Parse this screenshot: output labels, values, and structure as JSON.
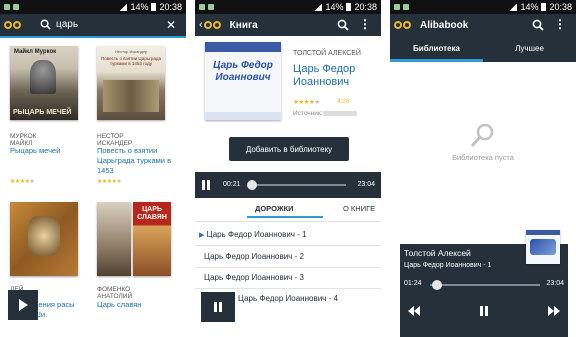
{
  "status": {
    "battery": "14%",
    "time": "20:38"
  },
  "screen1": {
    "search_query": "царь",
    "books": [
      {
        "author": "МУРКОК МАЙКЛ",
        "title": "Рыцарь мечей",
        "rating": 4,
        "cover_title": "РЫЦАРЬ МЕЧЕЙ",
        "cover_author": "Майкл Муркок"
      },
      {
        "author": "НЕСТОР ИСКАНДЕР",
        "title": "Повесть о взятии Царьграда турками в 1453",
        "rating": 4,
        "cover_title": "Повесть о взятии Царьграда турками в 1453 году",
        "cover_author": "Нестор Искандер"
      },
      {
        "author": "ДЕЙ ХОЛЛИ",
        "title": "ления расы Ши.",
        "rating": 0,
        "cover_title": "",
        "cover_author": ""
      },
      {
        "author": "ФОМЕНКО АНАТОЛИЙ",
        "title": "Царь славян",
        "rating": 0,
        "cover_title": "ЦАРЬ СЛАВЯН",
        "cover_author": ""
      }
    ]
  },
  "screen2": {
    "title": "Книга",
    "author": "ТОЛСТОЙ АЛЕКСЕЙ",
    "book_title": "Царь Федор Иоаннович",
    "rating": 4,
    "rating_value": "4.28",
    "source_label": "Источник:",
    "cover_text": "Царь Федор Иоаннович",
    "add_button": "Добавить в библиотеку",
    "current_time": "00:21",
    "total_time": "23:04",
    "progress": 0.02,
    "tabs": [
      "ДОРОЖКИ",
      "О КНИГЕ"
    ],
    "tracks": [
      "Царь Федор Иоаннович - 1",
      "Царь Федор Иоаннович - 2",
      "Царь Федор Иоаннович - 3",
      "Царь Федор Иоаннович - 4"
    ]
  },
  "screen3": {
    "title": "Alibabook",
    "tabs": [
      "Библиотека",
      "Лучшее"
    ],
    "empty_text": "Библиотека пуста",
    "player": {
      "author": "Толстой Алексей",
      "track": "Царь Федор Иоаннович - 1",
      "current_time": "01:24",
      "total_time": "23:04",
      "progress": 0.06
    }
  }
}
